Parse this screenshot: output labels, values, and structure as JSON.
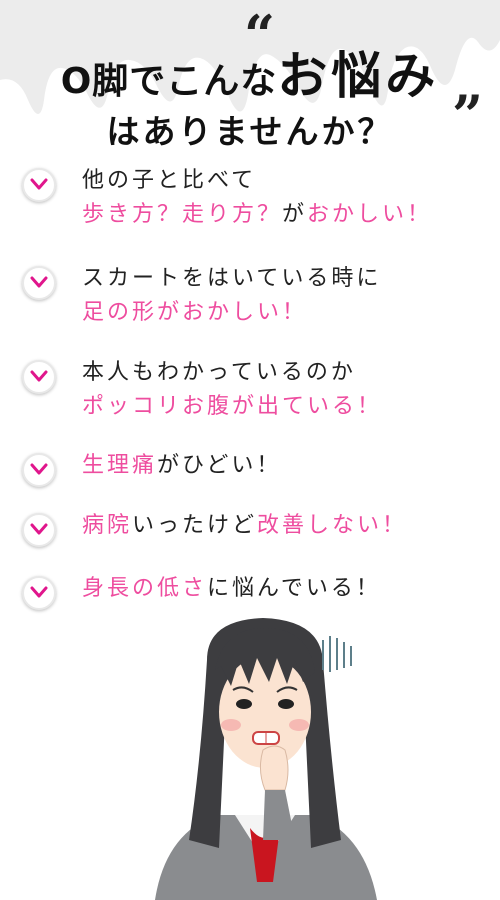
{
  "title": {
    "line1_prefix": "O脚でこんな",
    "line1_emphasis": "お悩み",
    "line2": "はありませんか？",
    "quote_open": "“",
    "quote_close": "”"
  },
  "items": [
    {
      "line1": [
        {
          "text": "他の子と比べて",
          "style": "dark"
        }
      ],
      "line2": [
        {
          "text": "歩き方？走り方？",
          "style": "pink"
        },
        {
          "text": "が",
          "style": "dark"
        },
        {
          "text": "おかしい！",
          "style": "pink"
        }
      ]
    },
    {
      "line1": [
        {
          "text": "スカートをはいている時に",
          "style": "dark"
        }
      ],
      "line2": [
        {
          "text": "足の形がおかしい！",
          "style": "pink"
        }
      ]
    },
    {
      "line1": [
        {
          "text": "本人もわかっているのか",
          "style": "dark"
        }
      ],
      "line2": [
        {
          "text": "ポッコリお腹が出ている！",
          "style": "pink"
        }
      ]
    },
    {
      "line1": [
        {
          "text": "生理痛",
          "style": "pink"
        },
        {
          "text": "がひどい！",
          "style": "dark"
        }
      ]
    },
    {
      "line1": [
        {
          "text": "病院",
          "style": "pink"
        },
        {
          "text": "いったけど",
          "style": "dark"
        },
        {
          "text": "改善しない！",
          "style": "pink"
        }
      ]
    },
    {
      "line1": [
        {
          "text": "身長の低さ",
          "style": "pink"
        },
        {
          "text": "に悩んでいる！",
          "style": "dark"
        }
      ]
    }
  ],
  "colors": {
    "pink": "#ee4d9f",
    "dark": "#222222",
    "check": "#e0168c"
  },
  "icons": {
    "check": "check-mark-icon",
    "illustration": "worried-girl-illustration"
  }
}
